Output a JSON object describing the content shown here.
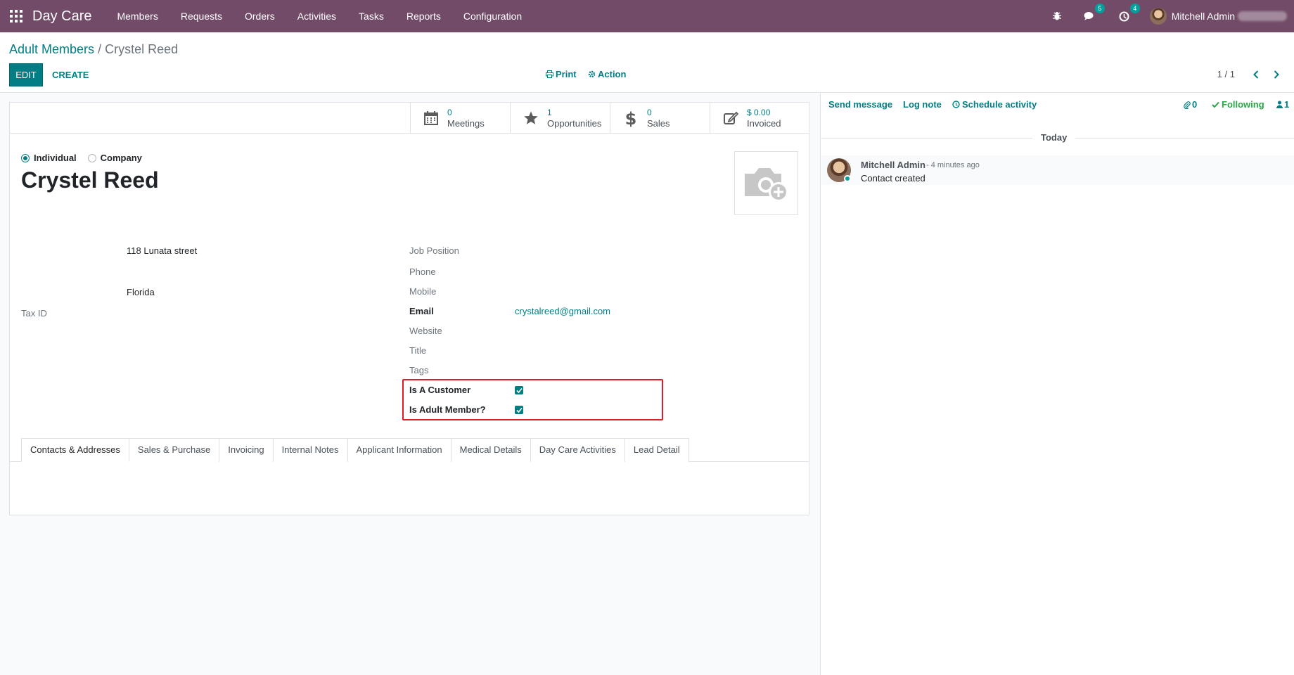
{
  "navbar": {
    "brand": "Day Care",
    "menu": [
      "Members",
      "Requests",
      "Orders",
      "Activities",
      "Tasks",
      "Reports",
      "Configuration"
    ],
    "messages_badge": "5",
    "activities_badge": "4",
    "user_name": "Mitchell Admin"
  },
  "breadcrumb": {
    "parent": "Adult Members",
    "separator": "/",
    "current": "Crystel Reed"
  },
  "buttons": {
    "edit": "EDIT",
    "create": "CREATE",
    "print": "Print",
    "action": "Action"
  },
  "pager": {
    "value": "1 / 1"
  },
  "stat_buttons": [
    {
      "value": "0",
      "label": "Meetings",
      "icon": "calendar-icon"
    },
    {
      "value": "1",
      "label": "Opportunities",
      "icon": "star-icon"
    },
    {
      "value": "0",
      "label": "Sales",
      "icon": "dollar-icon"
    },
    {
      "value": "$ 0.00",
      "label": "Invoiced",
      "icon": "edit-icon"
    }
  ],
  "company_type": {
    "individual": "Individual",
    "company": "Company",
    "selected": "individual"
  },
  "record": {
    "name": "Crystel Reed",
    "street": "118 Lunata street",
    "state": "Florida"
  },
  "fields": {
    "tax_id": {
      "label": "Tax ID",
      "value": ""
    },
    "job_position": {
      "label": "Job Position",
      "value": ""
    },
    "phone": {
      "label": "Phone",
      "value": ""
    },
    "mobile": {
      "label": "Mobile",
      "value": ""
    },
    "email": {
      "label": "Email",
      "value": "crystalreed@gmail.com"
    },
    "website": {
      "label": "Website",
      "value": ""
    },
    "title": {
      "label": "Title",
      "value": ""
    },
    "tags": {
      "label": "Tags",
      "value": ""
    },
    "is_customer": {
      "label": "Is A Customer",
      "checked": true
    },
    "is_adult_member": {
      "label": "Is Adult Member?",
      "checked": true
    }
  },
  "tabs": [
    "Contacts & Addresses",
    "Sales & Purchase",
    "Invoicing",
    "Internal Notes",
    "Applicant Information",
    "Medical Details",
    "Day Care Activities",
    "Lead Detail"
  ],
  "chatter": {
    "send_message": "Send message",
    "log_note": "Log note",
    "schedule_activity": "Schedule activity",
    "attachments_count": "0",
    "following": "Following",
    "followers_count": "1",
    "today": "Today",
    "message": {
      "author": "Mitchell Admin",
      "date": "- 4 minutes ago",
      "body": "Contact created"
    }
  },
  "colors": {
    "brand": "#714B67",
    "accent": "#017e84",
    "badge": "#00A09D",
    "highlight": "#e01b24",
    "following": "#28a745"
  }
}
